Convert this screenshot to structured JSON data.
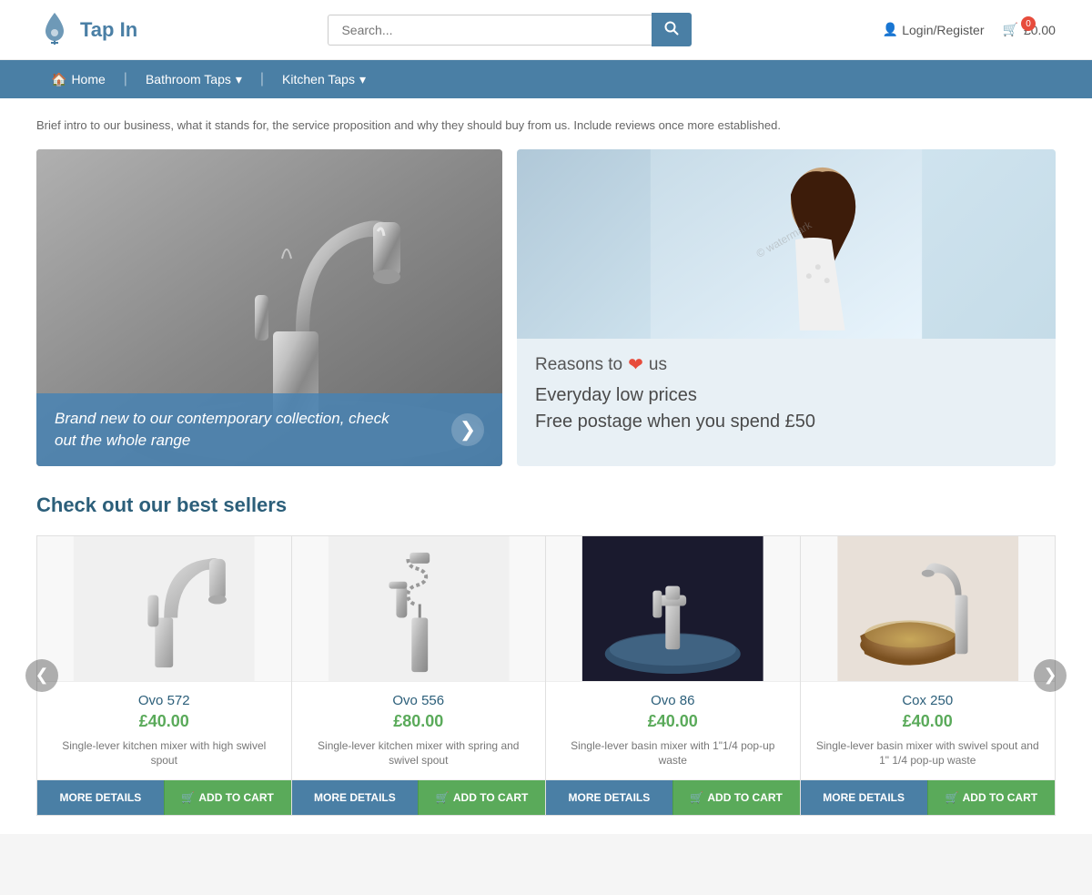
{
  "header": {
    "logo_text": "Tap In",
    "search_placeholder": "Search...",
    "search_btn_label": "🔍",
    "login_label": "Login/Register",
    "cart_count": "0",
    "cart_total": "£0.00"
  },
  "navbar": {
    "items": [
      {
        "label": "Home",
        "icon": "🏠",
        "has_dropdown": false
      },
      {
        "label": "Bathroom Taps",
        "icon": "",
        "has_dropdown": true
      },
      {
        "label": "Kitchen Taps",
        "icon": "",
        "has_dropdown": true
      }
    ]
  },
  "intro": {
    "text": "Brief intro to our business, what it stands for, the service proposition and why they should buy from us. Include reviews once more established."
  },
  "hero": {
    "main_caption": "Brand new to our contemporary collection, check out the whole range",
    "arrow_label": "❯",
    "reasons_label": "Reasons to",
    "reasons_suffix": "us",
    "benefits": [
      "Everyday low prices",
      "Free postage when you spend £50"
    ]
  },
  "best_sellers": {
    "title": "Check out our best sellers",
    "carousel_prev": "❮",
    "carousel_next": "❯",
    "products": [
      {
        "name": "Ovo 572",
        "price": "£40.00",
        "desc": "Single-lever kitchen mixer with high swivel spout",
        "btn_details": "MORE DETAILS",
        "btn_cart": "ADD TO CART"
      },
      {
        "name": "Ovo 556",
        "price": "£80.00",
        "desc": "Single-lever kitchen mixer with spring and swivel spout",
        "btn_details": "MORE DETAILS",
        "btn_cart": "ADD TO CART"
      },
      {
        "name": "Ovo 86",
        "price": "£40.00",
        "desc": "Single-lever basin mixer with 1\"1/4 pop-up waste",
        "btn_details": "MORE DETAILS",
        "btn_cart": "ADD TO CART"
      },
      {
        "name": "Cox 250",
        "price": "£40.00",
        "desc": "Single-lever basin mixer with swivel spout and 1\" 1/4 pop-up waste",
        "btn_details": "MORE DETAILS",
        "btn_cart": "ADD TO CART"
      }
    ]
  }
}
